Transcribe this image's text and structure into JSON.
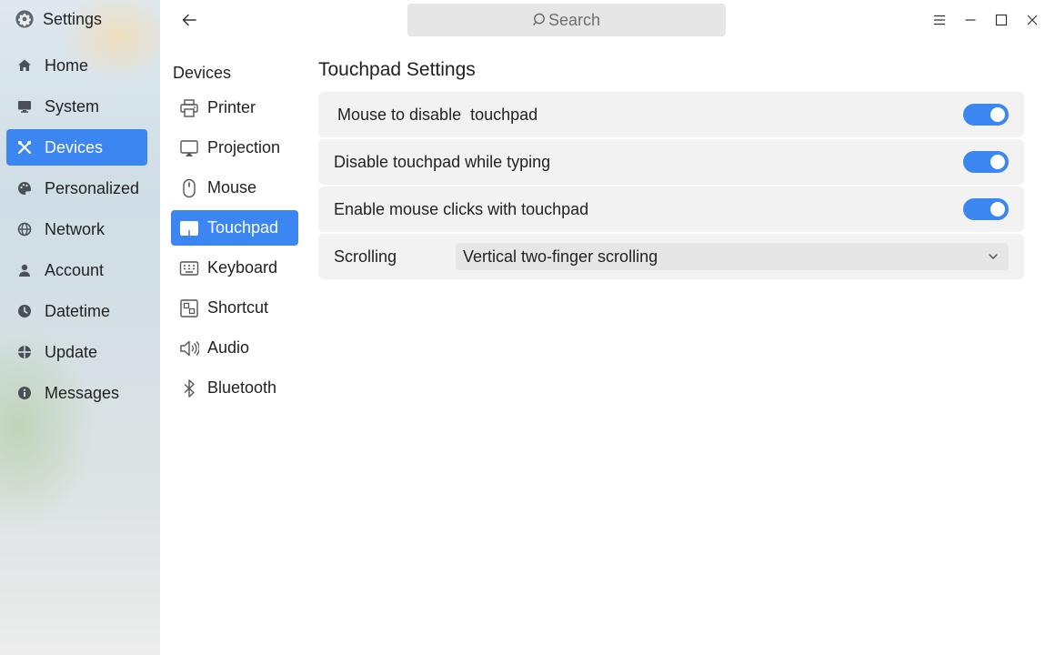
{
  "app": {
    "title": "Settings",
    "icon": "gear-icon"
  },
  "sidebar": {
    "items": [
      {
        "label": "Home",
        "icon": "home-icon",
        "active": false
      },
      {
        "label": "System",
        "icon": "monitor-icon",
        "active": false
      },
      {
        "label": "Devices",
        "icon": "devices-icon",
        "active": true
      },
      {
        "label": "Personalized",
        "icon": "palette-icon",
        "active": false
      },
      {
        "label": "Network",
        "icon": "globe-icon",
        "active": false
      },
      {
        "label": "Account",
        "icon": "user-icon",
        "active": false
      },
      {
        "label": "Datetime",
        "icon": "clock-icon",
        "active": false
      },
      {
        "label": "Update",
        "icon": "update-icon",
        "active": false
      },
      {
        "label": "Messages",
        "icon": "info-icon",
        "active": false
      }
    ]
  },
  "topbar": {
    "search_placeholder": "Search"
  },
  "devices": {
    "section_label": "Devices",
    "items": [
      {
        "label": "Printer",
        "icon": "printer-icon",
        "active": false
      },
      {
        "label": "Projection",
        "icon": "projection-icon",
        "active": false
      },
      {
        "label": "Mouse",
        "icon": "mouse-icon",
        "active": false
      },
      {
        "label": "Touchpad",
        "icon": "touchpad-icon",
        "active": true
      },
      {
        "label": "Keyboard",
        "icon": "keyboard-icon",
        "active": false
      },
      {
        "label": "Shortcut",
        "icon": "shortcut-icon",
        "active": false
      },
      {
        "label": "Audio",
        "icon": "speaker-icon",
        "active": false
      },
      {
        "label": "Bluetooth",
        "icon": "bluetooth-icon",
        "active": false
      }
    ]
  },
  "touchpad": {
    "title": "Touchpad Settings",
    "settings": [
      {
        "label": "Mouse to disable  touchpad",
        "enabled": true
      },
      {
        "label": "Disable touchpad while typing",
        "enabled": true
      },
      {
        "label": "Enable mouse clicks with touchpad",
        "enabled": true
      }
    ],
    "scrolling": {
      "label": "Scrolling",
      "value": "Vertical two-finger scrolling"
    }
  },
  "colors": {
    "accent": "#3b86f0",
    "row_bg": "#f2f2f2",
    "input_bg": "#e6e6e6"
  }
}
